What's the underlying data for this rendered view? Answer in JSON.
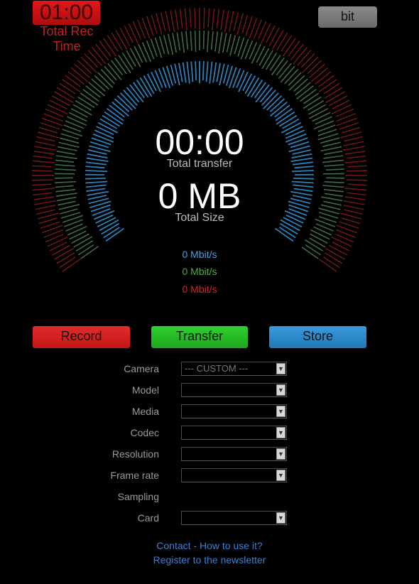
{
  "header": {
    "timer": "01:00",
    "timer_label": "Total Rec Time",
    "unit_toggle": "bit"
  },
  "gauge": {
    "colors": {
      "outer": "#7a1818",
      "middle": "#3e6a4a",
      "inner": "#2e7fb8"
    },
    "total_transfer_time": "00:00",
    "total_transfer_label": "Total transfer",
    "total_size": "0 MB",
    "total_size_label": "Total Size"
  },
  "rates": {
    "blue": "0 Mbit/s",
    "green": "0 Mbit/s",
    "red": "0 Mbit/s"
  },
  "buttons": {
    "record": "Record",
    "transfer": "Transfer",
    "store": "Store"
  },
  "form": {
    "camera_label": "Camera",
    "camera_value": "--- CUSTOM ---",
    "model_label": "Model",
    "model_value": "",
    "media_label": "Media",
    "media_value": "",
    "codec_label": "Codec",
    "codec_value": "",
    "resolution_label": "Resolution",
    "resolution_value": "",
    "framerate_label": "Frame rate",
    "framerate_value": "",
    "sampling_label": "Sampling",
    "card_label": "Card",
    "card_value": ""
  },
  "footer": {
    "contact": "Contact",
    "separator": " - ",
    "how_to": "How to use it?",
    "newsletter": "Register to the newsletter"
  }
}
